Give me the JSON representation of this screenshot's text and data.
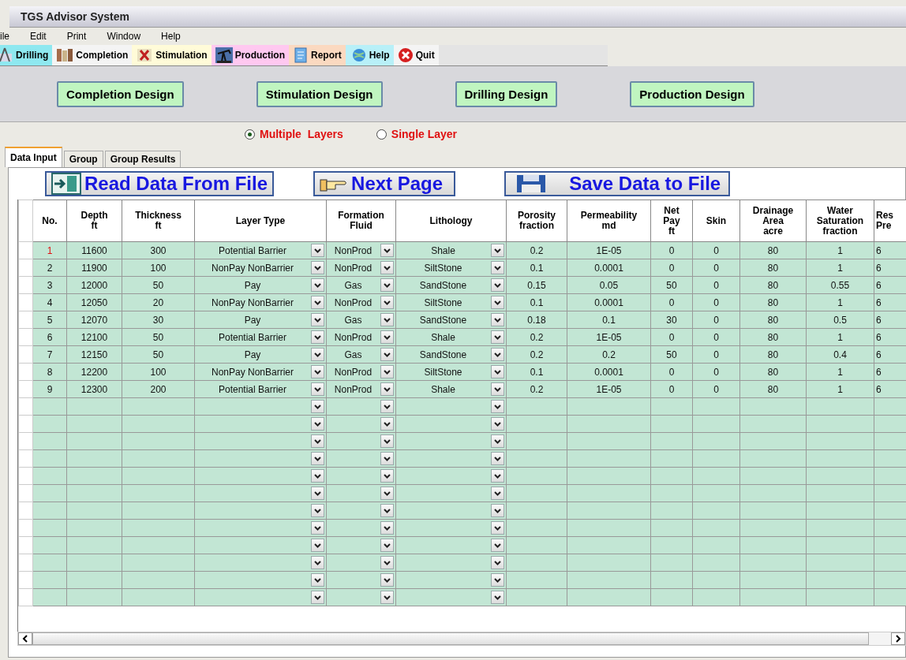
{
  "window": {
    "title": "TGS Advisor System"
  },
  "menu": [
    "ile",
    "Edit",
    "Print",
    "Window",
    "Help"
  ],
  "toolbar": [
    {
      "label": "Drilling",
      "color": "#8ee8f0",
      "kind": "drill"
    },
    {
      "label": "Completion",
      "color": "#f4f4f4",
      "kind": "completion"
    },
    {
      "label": "Stimulation",
      "color": "#fffbd8",
      "kind": "stimulation"
    },
    {
      "label": "Production",
      "color": "#ffc8f0",
      "kind": "production"
    },
    {
      "label": "Report",
      "color": "#fbd9c0",
      "kind": "report"
    },
    {
      "label": "Help",
      "color": "#b8f0f8",
      "kind": "help"
    },
    {
      "label": "Quit",
      "color": "#f4f4f4",
      "kind": "quit"
    }
  ],
  "design_buttons": [
    "Completion Design",
    "Stimulation Design",
    "Drilling Design",
    "Production Design"
  ],
  "layer_mode": [
    {
      "label": "Multiple  Layers",
      "selected": true
    },
    {
      "label": "Single Layer",
      "selected": false
    }
  ],
  "tabs": [
    {
      "label": "Data Input",
      "selected": true
    },
    {
      "label": "Group",
      "selected": false
    },
    {
      "label": "Group Results",
      "selected": false
    }
  ],
  "actions": [
    {
      "label": "Read Data From File",
      "kind": "door"
    },
    {
      "label": "Next Page",
      "kind": "hand"
    },
    {
      "label": "Save Data to File",
      "kind": "disk"
    }
  ],
  "table": {
    "columns": [
      {
        "label": "No.",
        "kind": "text"
      },
      {
        "label": "Depth\nft",
        "kind": "text"
      },
      {
        "label": "Thickness\nft",
        "kind": "text"
      },
      {
        "label": "Layer Type",
        "kind": "combo"
      },
      {
        "label": "Formation\nFluid",
        "kind": "combo"
      },
      {
        "label": "Lithology",
        "kind": "combo"
      },
      {
        "label": "Porosity\nfraction",
        "kind": "text"
      },
      {
        "label": "Permeability\nmd",
        "kind": "text"
      },
      {
        "label": "Net\nPay\nft",
        "kind": "text"
      },
      {
        "label": "Skin",
        "kind": "text"
      },
      {
        "label": "Drainage\nArea\nacre",
        "kind": "text"
      },
      {
        "label": "Water\nSaturation\nfraction",
        "kind": "text"
      },
      {
        "label": "Res\nPre",
        "kind": "text"
      }
    ],
    "rows": [
      {
        "selected": true,
        "cells": [
          "1",
          "11600",
          "300",
          "Potential Barrier",
          "NonProd",
          "Shale",
          "0.2",
          "1E-05",
          "0",
          "0",
          "80",
          "1",
          "6"
        ]
      },
      {
        "selected": false,
        "cells": [
          "2",
          "11900",
          "100",
          "NonPay NonBarrier",
          "NonProd",
          "SiltStone",
          "0.1",
          "0.0001",
          "0",
          "0",
          "80",
          "1",
          "6"
        ]
      },
      {
        "selected": false,
        "cells": [
          "3",
          "12000",
          "50",
          "Pay",
          "Gas",
          "SandStone",
          "0.15",
          "0.05",
          "50",
          "0",
          "80",
          "0.55",
          "6"
        ]
      },
      {
        "selected": false,
        "cells": [
          "4",
          "12050",
          "20",
          "NonPay NonBarrier",
          "NonProd",
          "SiltStone",
          "0.1",
          "0.0001",
          "0",
          "0",
          "80",
          "1",
          "6"
        ]
      },
      {
        "selected": false,
        "cells": [
          "5",
          "12070",
          "30",
          "Pay",
          "Gas",
          "SandStone",
          "0.18",
          "0.1",
          "30",
          "0",
          "80",
          "0.5",
          "6"
        ]
      },
      {
        "selected": false,
        "cells": [
          "6",
          "12100",
          "50",
          "Potential Barrier",
          "NonProd",
          "Shale",
          "0.2",
          "1E-05",
          "0",
          "0",
          "80",
          "1",
          "6"
        ]
      },
      {
        "selected": false,
        "cells": [
          "7",
          "12150",
          "50",
          "Pay",
          "Gas",
          "SandStone",
          "0.2",
          "0.2",
          "50",
          "0",
          "80",
          "0.4",
          "6"
        ]
      },
      {
        "selected": false,
        "cells": [
          "8",
          "12200",
          "100",
          "NonPay NonBarrier",
          "NonProd",
          "SiltStone",
          "0.1",
          "0.0001",
          "0",
          "0",
          "80",
          "1",
          "6"
        ]
      },
      {
        "selected": false,
        "cells": [
          "9",
          "12300",
          "200",
          "Potential Barrier",
          "NonProd",
          "Shale",
          "0.2",
          "1E-05",
          "0",
          "0",
          "80",
          "1",
          "6"
        ]
      }
    ],
    "blank_rows": [
      {
        "kind": "blank"
      },
      {
        "kind": "blank"
      },
      {
        "kind": "blank"
      },
      {
        "kind": "blank"
      },
      {
        "kind": "blank"
      },
      {
        "kind": "blank"
      },
      {
        "kind": "blank"
      },
      {
        "kind": "blank"
      },
      {
        "kind": "blank"
      },
      {
        "kind": "blank"
      },
      {
        "kind": "blank"
      },
      {
        "kind": "blank"
      }
    ]
  }
}
